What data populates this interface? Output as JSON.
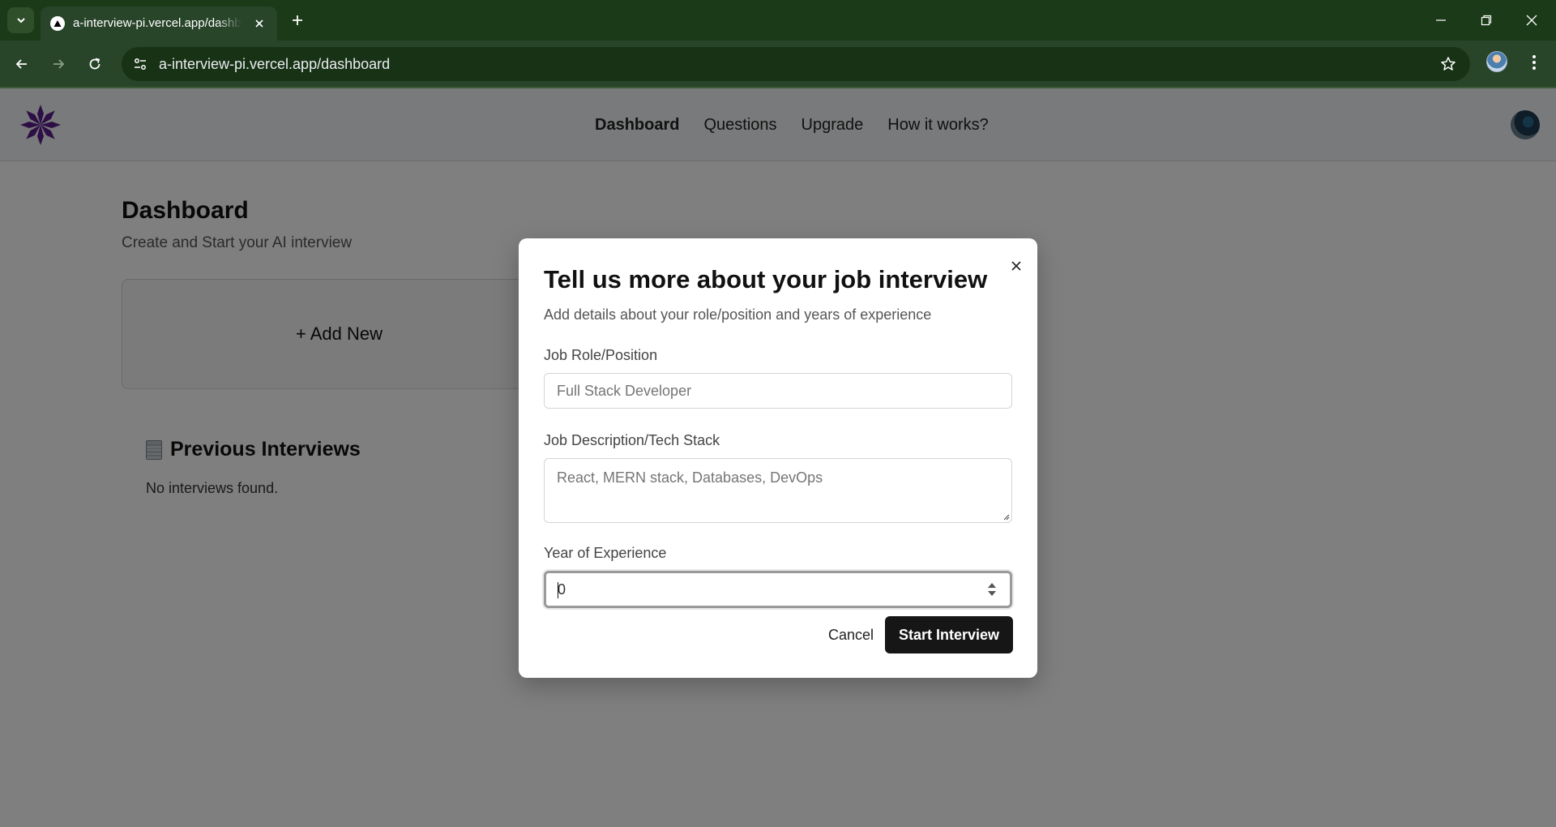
{
  "browser": {
    "tab_title": "a-interview-pi.vercel.app/dashb",
    "url": "a-interview-pi.vercel.app/dashboard"
  },
  "header": {
    "nav": [
      "Dashboard",
      "Questions",
      "Upgrade",
      "How it works?"
    ],
    "active_nav": "Dashboard"
  },
  "dashboard": {
    "title": "Dashboard",
    "subtitle": "Create and Start your AI interview",
    "add_new_label": "+ Add New",
    "previous_title": "Previous Interviews",
    "empty_text": "No interviews found."
  },
  "modal": {
    "title": "Tell us more about your job interview",
    "description": "Add details about your role/position and years of experience",
    "role_label": "Job Role/Position",
    "role_placeholder": "Full Stack Developer",
    "desc_label": "Job Description/Tech Stack",
    "desc_placeholder": "React, MERN stack, Databases, DevOps",
    "years_label": "Year of Experience",
    "years_value": "0",
    "cancel_label": "Cancel",
    "start_label": "Start Interview"
  },
  "colors": {
    "browser_frame": "#1b3a17",
    "toolbar": "#28452a",
    "logo_purple": "#5b1f8c",
    "start_button": "#161616"
  },
  "icons": {
    "tab_list": "chevron-down-icon",
    "tab_favicon": "vercel-triangle-icon",
    "tab_close": "close-icon",
    "new_tab": "plus-icon",
    "back": "arrow-left-icon",
    "forward": "arrow-right-icon",
    "reload": "reload-icon",
    "site_info": "tune-icon",
    "bookmark": "star-icon",
    "menu": "kebab-menu-icon",
    "logo": "asterisk-logo-icon",
    "previous_interviews": "document-icon",
    "modal_close": "close-icon",
    "stepper": "stepper-arrows-icon"
  }
}
